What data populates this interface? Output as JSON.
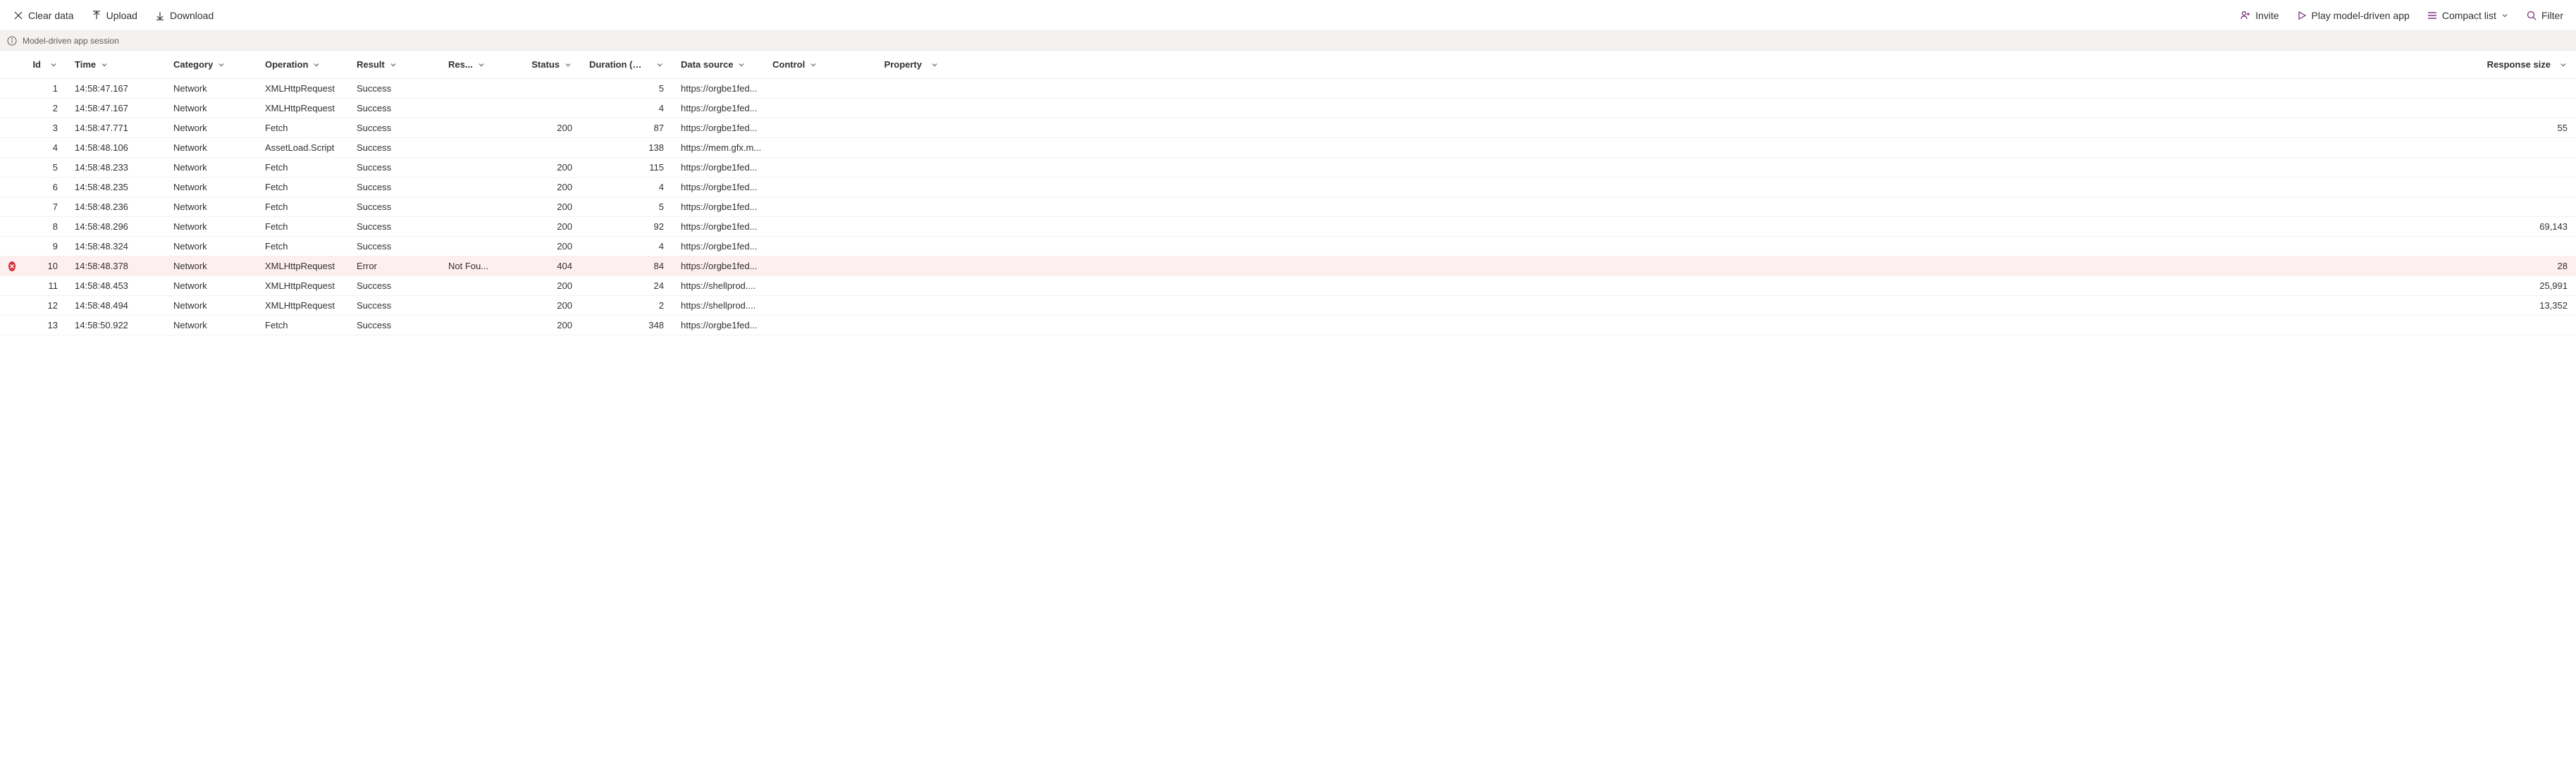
{
  "toolbar": {
    "clear_label": "Clear data",
    "upload_label": "Upload",
    "download_label": "Download",
    "invite_label": "Invite",
    "play_label": "Play model-driven app",
    "view_label": "Compact list",
    "filter_label": "Filter"
  },
  "session_bar": {
    "label": "Model-driven app session"
  },
  "columns": {
    "id": "Id",
    "time": "Time",
    "category": "Category",
    "operation": "Operation",
    "result": "Result",
    "res2": "Res...",
    "status": "Status",
    "duration": "Duration (ms)",
    "datasource": "Data source",
    "control": "Control",
    "property": "Property",
    "response": "Response size"
  },
  "rows": [
    {
      "id": "1",
      "time": "14:58:47.167",
      "category": "Network",
      "operation": "XMLHttpRequest",
      "result": "Success",
      "res2": "",
      "status": "",
      "duration": "5",
      "datasource": "https://orgbe1fed...",
      "control": "",
      "property": "",
      "response": "",
      "error": false
    },
    {
      "id": "2",
      "time": "14:58:47.167",
      "category": "Network",
      "operation": "XMLHttpRequest",
      "result": "Success",
      "res2": "",
      "status": "",
      "duration": "4",
      "datasource": "https://orgbe1fed...",
      "control": "",
      "property": "",
      "response": "",
      "error": false
    },
    {
      "id": "3",
      "time": "14:58:47.771",
      "category": "Network",
      "operation": "Fetch",
      "result": "Success",
      "res2": "",
      "status": "200",
      "duration": "87",
      "datasource": "https://orgbe1fed...",
      "control": "",
      "property": "",
      "response": "55",
      "error": false
    },
    {
      "id": "4",
      "time": "14:58:48.106",
      "category": "Network",
      "operation": "AssetLoad.Script",
      "result": "Success",
      "res2": "",
      "status": "",
      "duration": "138",
      "datasource": "https://mem.gfx.m...",
      "control": "",
      "property": "",
      "response": "",
      "error": false
    },
    {
      "id": "5",
      "time": "14:58:48.233",
      "category": "Network",
      "operation": "Fetch",
      "result": "Success",
      "res2": "",
      "status": "200",
      "duration": "115",
      "datasource": "https://orgbe1fed...",
      "control": "",
      "property": "",
      "response": "",
      "error": false
    },
    {
      "id": "6",
      "time": "14:58:48.235",
      "category": "Network",
      "operation": "Fetch",
      "result": "Success",
      "res2": "",
      "status": "200",
      "duration": "4",
      "datasource": "https://orgbe1fed...",
      "control": "",
      "property": "",
      "response": "",
      "error": false
    },
    {
      "id": "7",
      "time": "14:58:48.236",
      "category": "Network",
      "operation": "Fetch",
      "result": "Success",
      "res2": "",
      "status": "200",
      "duration": "5",
      "datasource": "https://orgbe1fed...",
      "control": "",
      "property": "",
      "response": "",
      "error": false
    },
    {
      "id": "8",
      "time": "14:58:48.296",
      "category": "Network",
      "operation": "Fetch",
      "result": "Success",
      "res2": "",
      "status": "200",
      "duration": "92",
      "datasource": "https://orgbe1fed...",
      "control": "",
      "property": "",
      "response": "69,143",
      "error": false
    },
    {
      "id": "9",
      "time": "14:58:48.324",
      "category": "Network",
      "operation": "Fetch",
      "result": "Success",
      "res2": "",
      "status": "200",
      "duration": "4",
      "datasource": "https://orgbe1fed...",
      "control": "",
      "property": "",
      "response": "",
      "error": false
    },
    {
      "id": "10",
      "time": "14:58:48.378",
      "category": "Network",
      "operation": "XMLHttpRequest",
      "result": "Error",
      "res2": "Not Fou...",
      "status": "404",
      "duration": "84",
      "datasource": "https://orgbe1fed...",
      "control": "",
      "property": "",
      "response": "28",
      "error": true
    },
    {
      "id": "11",
      "time": "14:58:48.453",
      "category": "Network",
      "operation": "XMLHttpRequest",
      "result": "Success",
      "res2": "",
      "status": "200",
      "duration": "24",
      "datasource": "https://shellprod....",
      "control": "",
      "property": "",
      "response": "25,991",
      "error": false
    },
    {
      "id": "12",
      "time": "14:58:48.494",
      "category": "Network",
      "operation": "XMLHttpRequest",
      "result": "Success",
      "res2": "",
      "status": "200",
      "duration": "2",
      "datasource": "https://shellprod....",
      "control": "",
      "property": "",
      "response": "13,352",
      "error": false
    },
    {
      "id": "13",
      "time": "14:58:50.922",
      "category": "Network",
      "operation": "Fetch",
      "result": "Success",
      "res2": "",
      "status": "200",
      "duration": "348",
      "datasource": "https://orgbe1fed...",
      "control": "",
      "property": "",
      "response": "",
      "error": false
    }
  ]
}
